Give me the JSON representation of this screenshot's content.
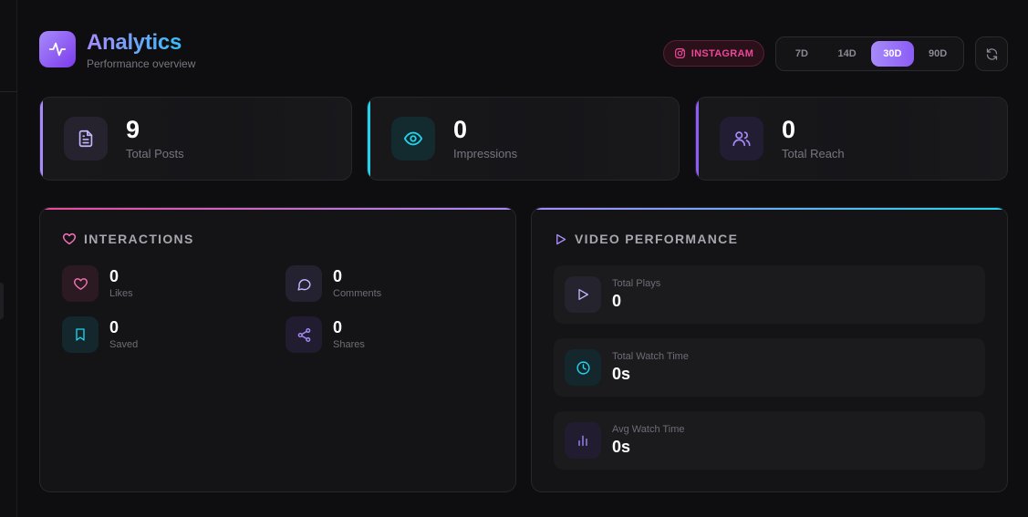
{
  "header": {
    "title": "Analytics",
    "subtitle": "Performance overview",
    "platform": "INSTAGRAM",
    "ranges": [
      "7D",
      "14D",
      "30D",
      "90D"
    ],
    "active_range": "30D"
  },
  "stats": [
    {
      "value": "9",
      "label": "Total Posts",
      "icon": "document-icon",
      "accent": "#a78bfa"
    },
    {
      "value": "0",
      "label": "Impressions",
      "icon": "eye-icon",
      "accent": "#22d3ee"
    },
    {
      "value": "0",
      "label": "Total Reach",
      "icon": "users-icon",
      "accent": "#8b5cf6"
    }
  ],
  "interactions": {
    "title": "INTERACTIONS",
    "items": [
      {
        "value": "0",
        "label": "Likes",
        "icon": "heart-icon"
      },
      {
        "value": "0",
        "label": "Comments",
        "icon": "comment-icon"
      },
      {
        "value": "0",
        "label": "Saved",
        "icon": "bookmark-icon"
      },
      {
        "value": "0",
        "label": "Shares",
        "icon": "share-icon"
      }
    ]
  },
  "video": {
    "title": "VIDEO PERFORMANCE",
    "rows": [
      {
        "label": "Total Plays",
        "value": "0",
        "icon": "play-icon"
      },
      {
        "label": "Total Watch Time",
        "value": "0s",
        "icon": "clock-icon"
      },
      {
        "label": "Avg Watch Time",
        "value": "0s",
        "icon": "bar-chart-icon"
      }
    ]
  },
  "colors": {
    "purple": "#a78bfa",
    "cyan": "#22d3ee",
    "pink": "#ec4899",
    "violet": "#8b5cf6"
  }
}
